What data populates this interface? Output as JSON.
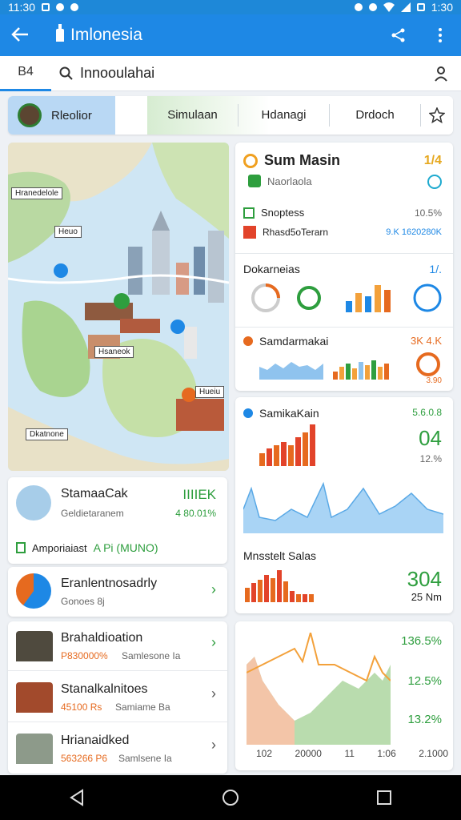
{
  "status": {
    "time": "11:30",
    "right_text": "1:30"
  },
  "appbar": {
    "title": "Imlonesia"
  },
  "search": {
    "tab_label": "B4",
    "query": "Innooulahai"
  },
  "filters": {
    "active_chip": "Rleolior",
    "chips": [
      "Simulaan",
      "Hdanagi",
      "Drdoch"
    ]
  },
  "map": {
    "labels": [
      "Hranedelole",
      "Heuo",
      "Hsaneok",
      "Hueiu",
      "Dkatnone"
    ]
  },
  "summary": {
    "title": "Sum Masin",
    "corner_value": "1/4",
    "subtitle": "Naorlaola",
    "row1_label": "Snoptess",
    "row1_value": "10.5%",
    "row2_label": "Rhasd5oTerarn",
    "row2_value": "9.K 1620280K"
  },
  "dokarneias": {
    "title": "Dokarneias",
    "corner": "1/."
  },
  "samdarmakai": {
    "title": "Samdarmakai",
    "value": "3K 4.K",
    "sub_value": "3.90"
  },
  "samika": {
    "title": "SamikaKain",
    "badge": "5.6.0.8",
    "big_value": "04",
    "percent": "12.%",
    "sub_title": "Mnsstelt Salas",
    "big_value2": "304",
    "unit": "25 Nm"
  },
  "bottom_chart": {
    "labels_right": [
      "136.5%",
      "12.5%",
      "13.2%"
    ],
    "x_ticks": [
      "102",
      "20000",
      "11",
      "1:06",
      "2.1000"
    ]
  },
  "list1": {
    "item1_title": "StamaaCak",
    "item1_sub": "Geldietaranem",
    "item1_value": "IIIIEK",
    "item1_value2": "4 80.01%",
    "tag": "Amporiaiast",
    "tag_value": "A Pi (MUNO)"
  },
  "list2": {
    "title": "Eranlentnosadrly",
    "sub": "Gonoes 8j"
  },
  "list3": {
    "items": [
      {
        "title": "Brahaldioation",
        "price": "P830000%",
        "sub": "Samlesone Ia"
      },
      {
        "title": "Stanalkalnitoes",
        "price": "45100 Rs",
        "sub": "Samiame Ba"
      },
      {
        "title": "Hrianaidked",
        "price": "563266 P6",
        "sub": "Samlsene Ia"
      }
    ]
  }
}
